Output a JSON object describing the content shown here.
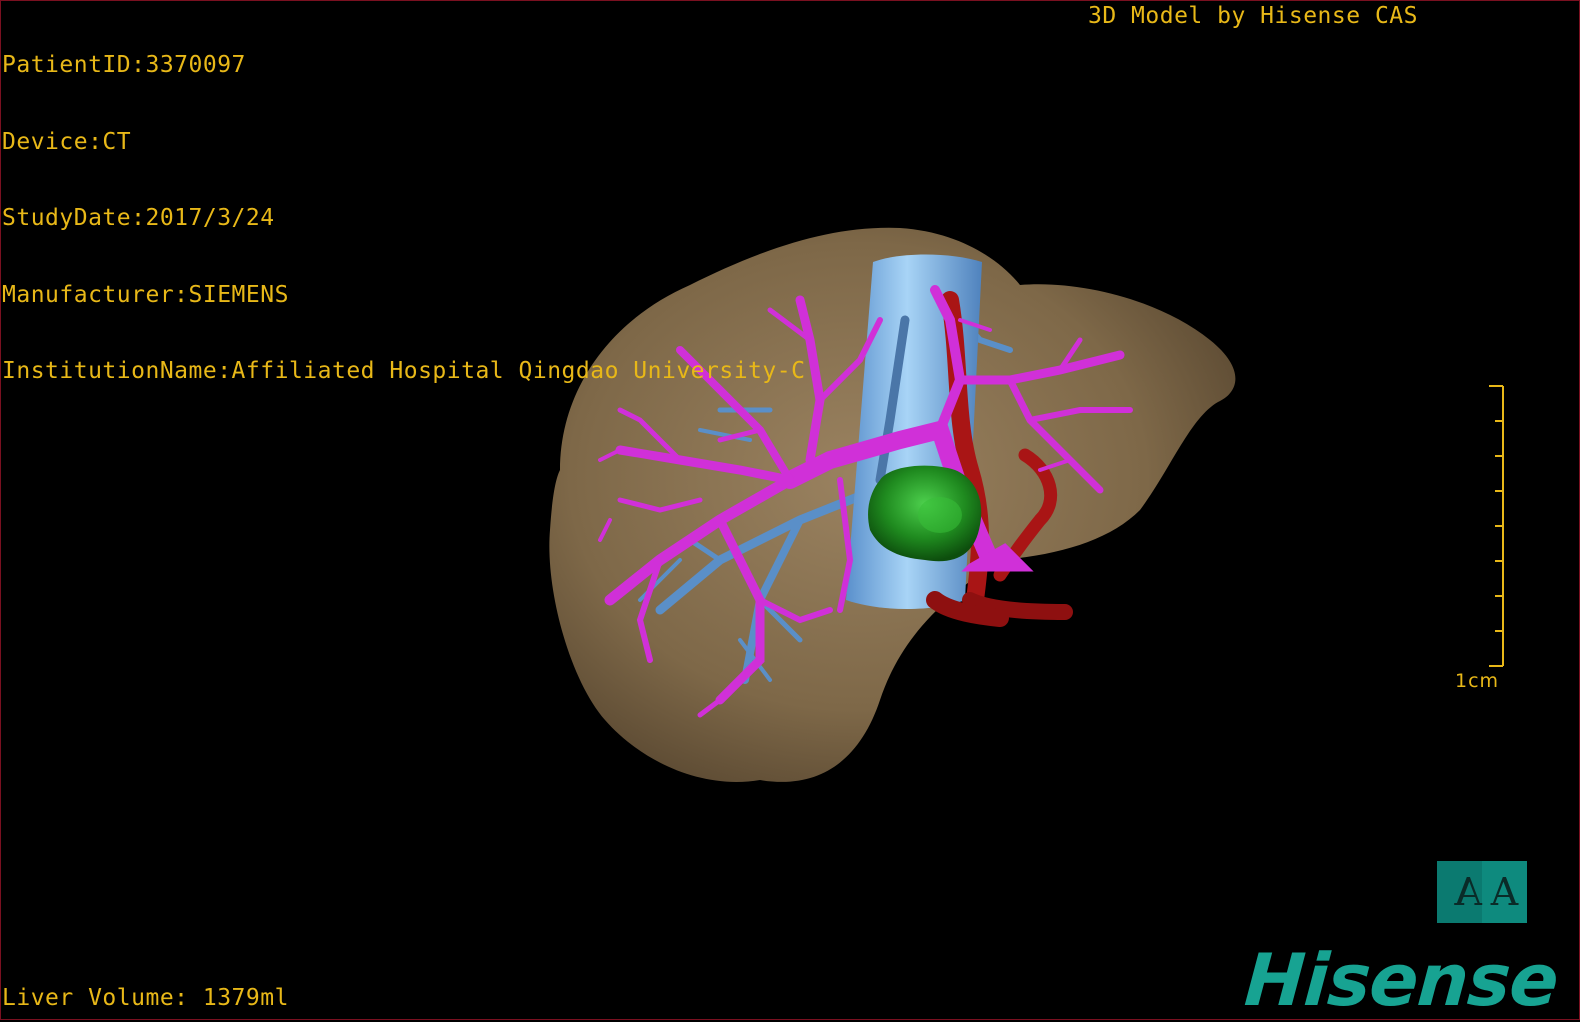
{
  "overlay": {
    "patient_id": "PatientID:3370097",
    "device": "Device:CT",
    "study_date": "StudyDate:2017/3/24",
    "manufacturer": "Manufacturer:SIEMENS",
    "institution": "InstitutionName:Affiliated Hospital Qingdao University-C",
    "model_credit": "3D Model by Hisense CAS",
    "liver_volume": "Liver Volume: 1379ml"
  },
  "scale_bar": {
    "label": "1cm"
  },
  "orientation_cube": {
    "back_label": "A",
    "front_label": "A"
  },
  "brand": {
    "logo_text": "Hisense"
  },
  "colors": {
    "text": "#e8b818",
    "liver": "#8a7352",
    "inferior_vena_cava": "#78b4e6",
    "hepatic_vein": "#5a8fc8",
    "portal_vein": "#d030d8",
    "artery": "#b01818",
    "tumor": "#1f9a1f",
    "brand": "#17a392"
  }
}
